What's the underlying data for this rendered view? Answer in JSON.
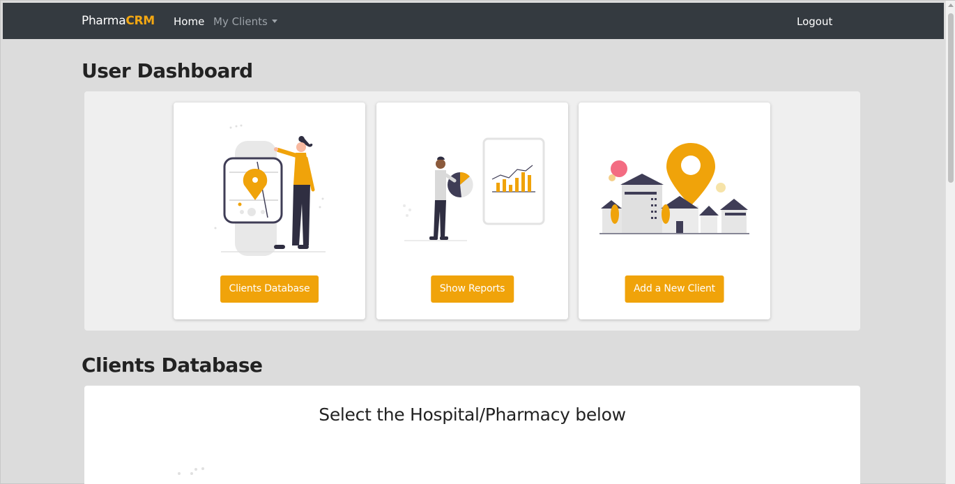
{
  "navbar": {
    "brand_part1": "Pharma",
    "brand_part2": "CRM",
    "home_label": "Home",
    "clients_menu_label": "My Clients",
    "logout_label": "Logout"
  },
  "dashboard": {
    "title": "User Dashboard",
    "cards": [
      {
        "button_label": "Clients Database",
        "illustration": "smartwatch-map-pin-illustration"
      },
      {
        "button_label": "Show Reports",
        "illustration": "reports-chart-illustration"
      },
      {
        "button_label": "Add a New Client",
        "illustration": "city-location-pin-illustration"
      }
    ]
  },
  "clients_database": {
    "title": "Clients Database",
    "select_heading": "Select the Hospital/Pharmacy below"
  },
  "colors": {
    "navbar_bg": "#343a40",
    "accent": "#f0a30a",
    "page_bg": "#dcdcdc"
  }
}
